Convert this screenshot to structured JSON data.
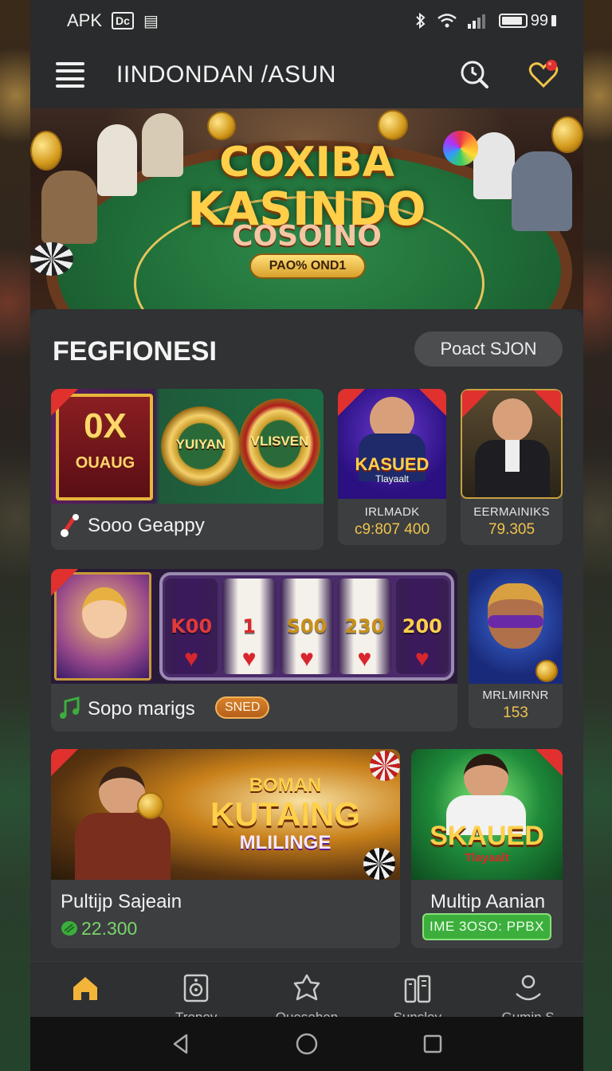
{
  "status_bar": {
    "carrier": "APK",
    "badge_1": "Dc",
    "badge_2": "▤",
    "battery_text": "99",
    "battery_level": 0.9
  },
  "header": {
    "title": "IINDONDAN /ASUN",
    "search_icon": "search-clock-icon",
    "favorites_icon": "heart-icon"
  },
  "hero": {
    "line1": "COXIBA",
    "line2": "KASINDO",
    "line3": "COSOINO",
    "button_label": "PAO% OND1"
  },
  "section": {
    "title": "FEGFIONESI",
    "action_label": "Poact SJON"
  },
  "cards": {
    "c1": {
      "art_text_1": "0X",
      "art_text_2": "OUAUG",
      "art_text_3": "YUIYAN",
      "art_text_4": "VLISVEN",
      "label": "Sooo Geappy"
    },
    "c2": {
      "art_text_1": "KASUED",
      "art_text_2": "Tlayaalt",
      "name": "IRLMADK",
      "value": "c9:807 400"
    },
    "c3": {
      "name": "EERMAINIKS",
      "value": "79.305"
    },
    "c4": {
      "reels": [
        "K00",
        "1",
        "S00",
        "230",
        "200"
      ],
      "label": "Sopo marigs",
      "badge": "SNED"
    },
    "c5": {
      "name": "MRLMIRNR",
      "value": "153"
    },
    "c6": {
      "art_text_1": "BOMAN",
      "art_text_2": "KUTAING",
      "art_text_3": "MLILINGE",
      "label": "Pultijp Sajeain",
      "value": "22.300"
    },
    "c7": {
      "art_text_1": "SKAUED",
      "art_text_2": "Tlayaalt",
      "label": "Multip Aanian",
      "pill": "IME 3OSO: PPBX"
    }
  },
  "bottom_nav": [
    {
      "label": "",
      "icon": "home-icon"
    },
    {
      "label": "Tropey",
      "icon": "speaker-icon"
    },
    {
      "label": "Ouesehen",
      "icon": "star-icon"
    },
    {
      "label": "Sunsley",
      "icon": "devices-icon"
    },
    {
      "label": "Gumin S",
      "icon": "user-icon"
    }
  ],
  "colors": {
    "accent_gold": "#f0c34a",
    "tag_red": "#e0312e",
    "green": "#3cae3c",
    "panel": "#303233"
  }
}
